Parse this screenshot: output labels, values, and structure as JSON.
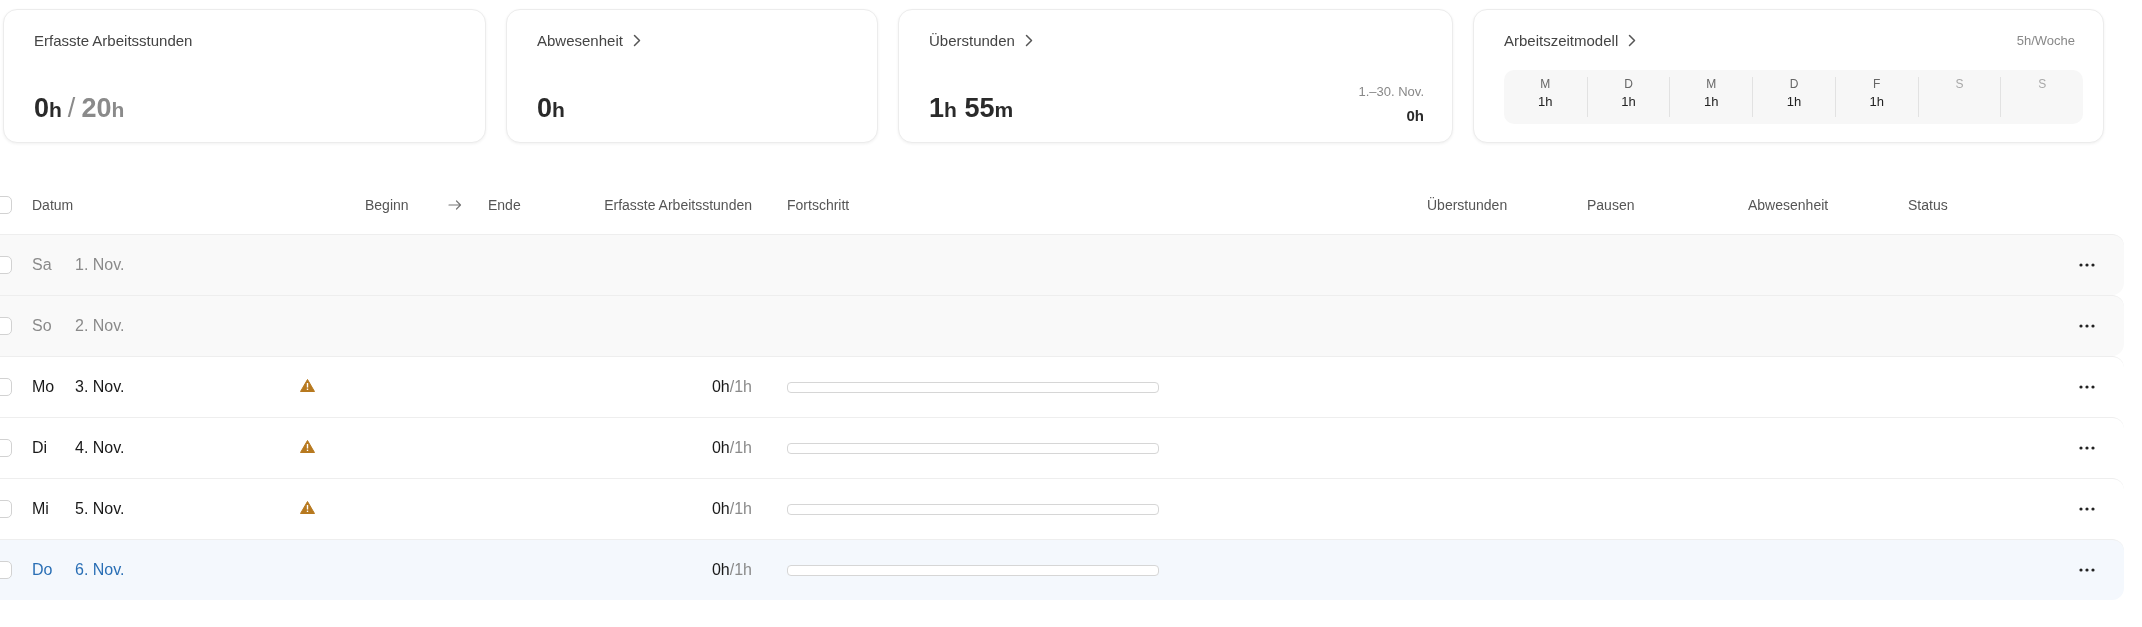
{
  "summary_cards": [
    {
      "kind": "total",
      "title": "Erfasste Arbeitsstunden",
      "link": false,
      "value": [
        {
          "number": "0",
          "unit": "h"
        }
      ],
      "separator": "/",
      "target": [
        {
          "number": "20",
          "unit": "h"
        }
      ]
    },
    {
      "kind": "simple",
      "title": "Abwesenheit",
      "link": true,
      "value": [
        {
          "number": "0",
          "unit": "h"
        }
      ]
    },
    {
      "kind": "overtime",
      "title": "Überstunden",
      "link": true,
      "value": [
        {
          "number": "1",
          "unit": "h"
        },
        {
          "number": "55",
          "unit": "m"
        }
      ],
      "period": "1.–30. Nov.",
      "period_value": "0h"
    },
    {
      "kind": "model",
      "title": "Arbeitszeitmodell",
      "link": true,
      "per_week": "5h/Woche",
      "days": [
        {
          "label": "M",
          "hours": "1h",
          "off": false
        },
        {
          "label": "D",
          "hours": "1h",
          "off": false
        },
        {
          "label": "M",
          "hours": "1h",
          "off": false
        },
        {
          "label": "D",
          "hours": "1h",
          "off": false
        },
        {
          "label": "F",
          "hours": "1h",
          "off": false
        },
        {
          "label": "S",
          "off": true
        },
        {
          "label": "S",
          "off": true
        }
      ]
    }
  ],
  "table": {
    "columns": [
      "Datum",
      "Beginn",
      "Ende",
      "Erfasste Arbeitsstunden",
      "Fortschritt",
      "Überstunden",
      "Pausen",
      "Abwesenheit",
      "Status"
    ],
    "select_all_checked": false,
    "rows": [
      {
        "kind": "weekend",
        "day": "Sa",
        "date": "1. Nov.",
        "checked": false,
        "warning": false
      },
      {
        "kind": "weekend",
        "day": "So",
        "date": "2. Nov.",
        "checked": false,
        "warning": false
      },
      {
        "kind": "workday",
        "day": "Mo",
        "date": "3. Nov.",
        "checked": false,
        "warning": true,
        "recorded": "0h",
        "target": "/1h",
        "level": 0
      },
      {
        "kind": "workday",
        "day": "Di",
        "date": "4. Nov.",
        "checked": false,
        "warning": true,
        "recorded": "0h",
        "target": "/1h",
        "level": 0
      },
      {
        "kind": "workday",
        "day": "Mi",
        "date": "5. Nov.",
        "checked": false,
        "warning": true,
        "recorded": "0h",
        "target": "/1h",
        "level": 0
      },
      {
        "kind": "today",
        "day": "Do",
        "date": "6. Nov.",
        "checked": false,
        "warning": false,
        "recorded": "0h",
        "target": "/1h",
        "level": 0
      }
    ]
  }
}
